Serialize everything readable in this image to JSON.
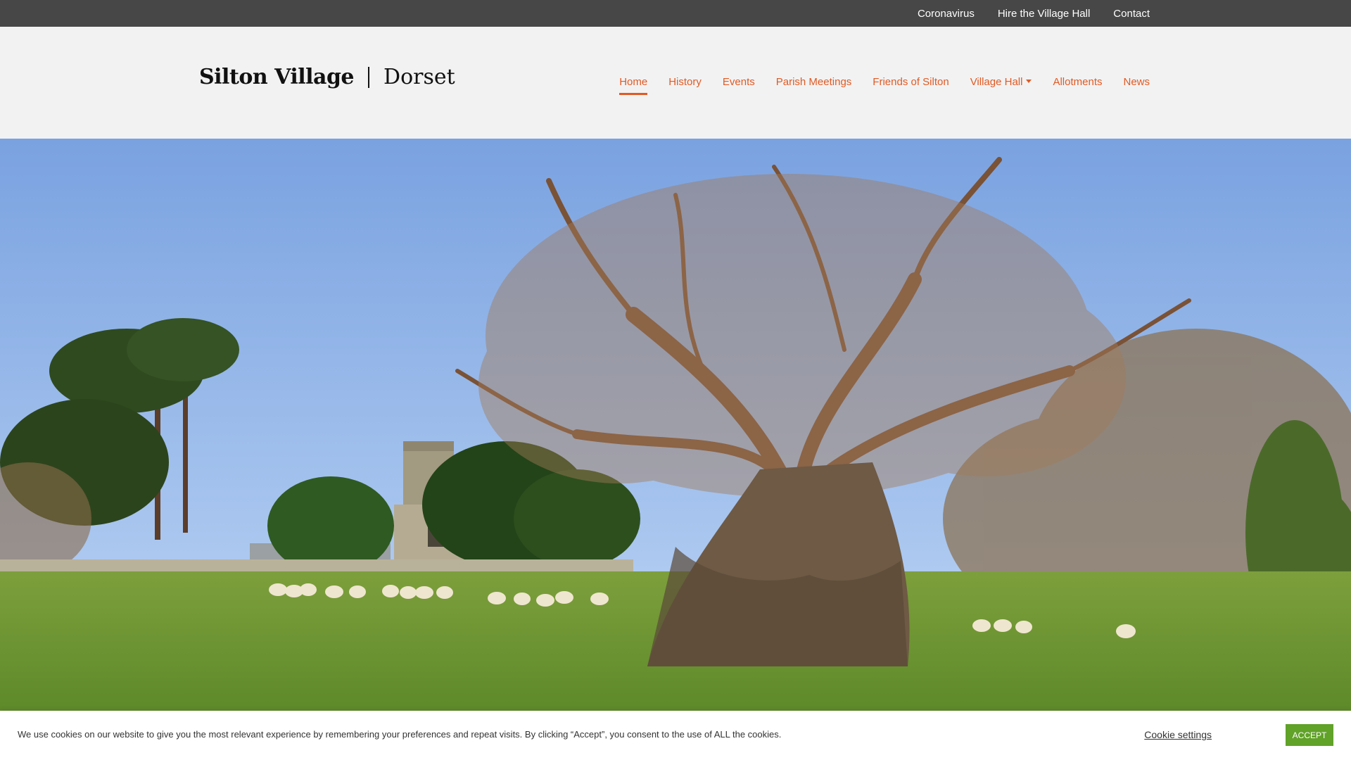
{
  "topbar": {
    "links": [
      "Coronavirus",
      "Hire the Village Hall",
      "Contact"
    ]
  },
  "header": {
    "logo_name": "Silton Village",
    "logo_place": "Dorset",
    "nav": {
      "home": "Home",
      "history": "History",
      "events": "Events",
      "parish_meetings": "Parish Meetings",
      "friends": "Friends of Silton",
      "village_hall": "Village Hall",
      "allotments": "Allotments",
      "news": "News"
    },
    "active_item": "Home"
  },
  "hero": {
    "description_icon": "landscape-photo"
  },
  "cookie_banner": {
    "text": "We use cookies on our website to give you the most relevant experience by remembering your preferences and repeat visits. By clicking “Accept”, you consent to the use of ALL the cookies.",
    "settings_label": "Cookie settings",
    "accept_label": "ACCEPT"
  },
  "colors": {
    "topbar_bg": "#474747",
    "header_bg": "#f2f2f2",
    "accent": "#e05a24",
    "accept_button": "#61a229"
  }
}
